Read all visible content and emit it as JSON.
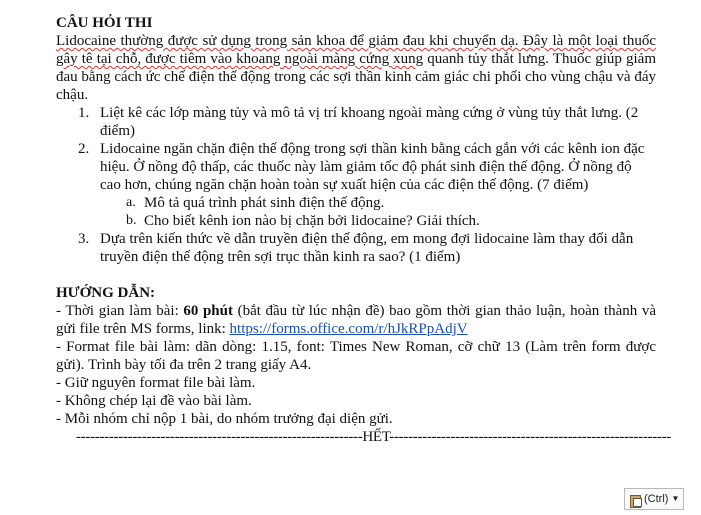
{
  "title": "CÂU HỎI THI",
  "intro": {
    "lead": "Lidocaine thường được sử dụng trong sản khoa để giảm đau khi chuyển dạ. Đây là một loại thuốc gây tê tại chỗ, được tiêm vào khoang ngoài màng cứng xung",
    "rest": " quanh tủy thắt lưng. Thuốc giúp giảm đau bằng cách ức chế điện thế động trong các sợi thần kinh cảm giác chi phối cho vùng chậu và đáy chậu."
  },
  "questions": [
    {
      "num": "1.",
      "text": "Liệt kê các lớp màng tủy và mô tả vị trí khoang ngoài màng cứng ở vùng tủy thắt lưng. (2 điểm)"
    },
    {
      "num": "2.",
      "text": "Lidocaine ngăn chặn điện thế động trong sợi thần kinh bằng cách gắn với các kênh ion đặc hiệu. Ở nồng độ thấp, các thuốc này làm giảm tốc độ phát sinh điện thế động. Ở nồng độ cao hơn, chúng ngăn chặn hoàn toàn sự xuất hiện của các điện thế động. (7 điểm)",
      "sub": [
        {
          "letter": "a.",
          "text": "Mô tả quá trình phát sinh điện thế động."
        },
        {
          "letter": "b.",
          "text": "Cho biết kênh ion nào bị chặn bởi lidocaine? Giải thích."
        }
      ]
    },
    {
      "num": "3.",
      "text": "Dựa trên kiến thức về dẫn truyền điện thế động, em mong đợi lidocaine làm thay đổi dẫn truyền điện thế động trên sợi trục thần kinh ra sao? (1 điểm)"
    }
  ],
  "guide": {
    "heading": "HƯỚNG DẪN:",
    "time_prefix": "- Thời gian làm bài: ",
    "time_bold": "60 phút",
    "time_rest": " (bắt đầu từ lúc nhận đề) bao gồm thời gian thảo luận, hoàn thành và gửi file trên MS forms, link: ",
    "link": "https://forms.office.com/r/hJkRPpAdjV",
    "lines": [
      "- Format file bài làm: dãn dòng: 1.15, font: Times New Roman, cỡ chữ 13 (Làm trên form được gửi). Trình bày tối đa trên 2 trang giấy A4.",
      "- Giữ nguyên format file bài làm.",
      "- Không chép lại đề vào bài làm.",
      "- Mỗi nhóm chỉ nộp 1 bài, do nhóm trưởng đại diện gửi."
    ],
    "end": "-------------------------------------------------------------HẾT------------------------------------------------------------"
  },
  "paste_options": {
    "label": "(Ctrl)",
    "icon": "clipboard-icon"
  }
}
